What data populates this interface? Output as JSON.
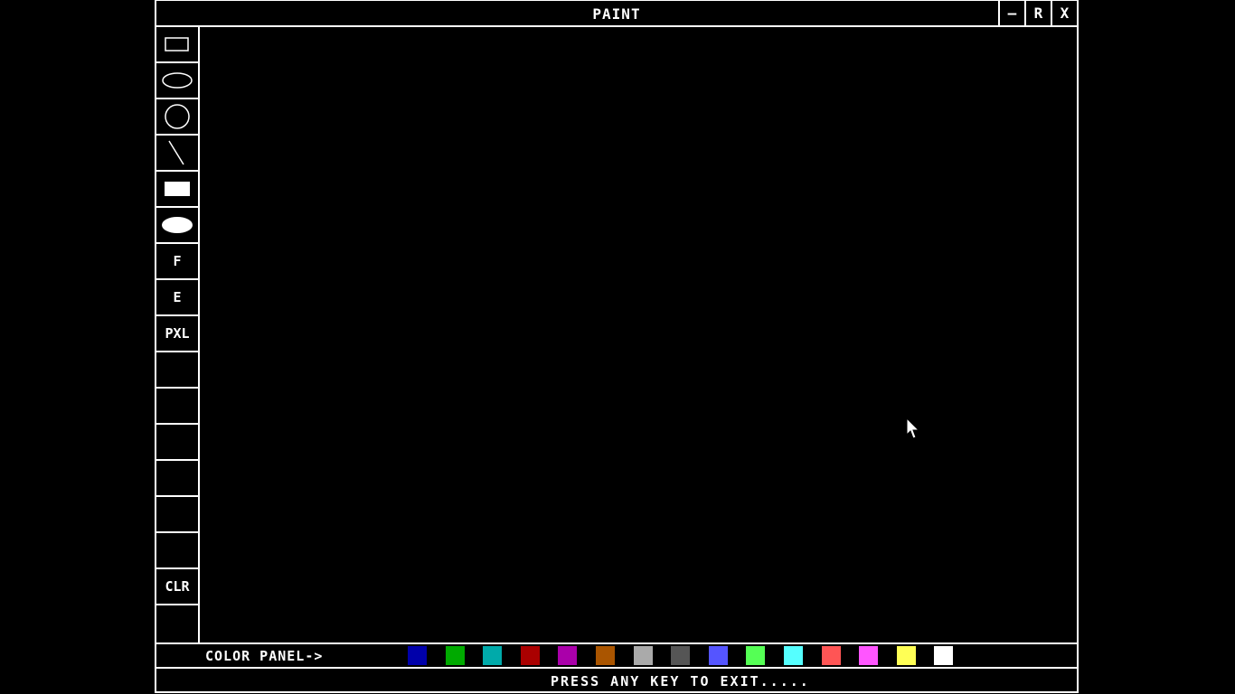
{
  "window": {
    "title": "PAINT",
    "controls": {
      "minimize": "–",
      "restore": "R",
      "close": "X"
    }
  },
  "toolbar": {
    "tools": [
      {
        "name": "rectangle-outline",
        "label": ""
      },
      {
        "name": "ellipse-outline",
        "label": ""
      },
      {
        "name": "circle-outline",
        "label": ""
      },
      {
        "name": "line",
        "label": ""
      },
      {
        "name": "rectangle-filled",
        "label": ""
      },
      {
        "name": "ellipse-filled",
        "label": ""
      },
      {
        "name": "fill",
        "label": "F"
      },
      {
        "name": "eraser",
        "label": "E"
      },
      {
        "name": "pixel",
        "label": "PXL"
      },
      {
        "name": "empty-1",
        "label": ""
      },
      {
        "name": "empty-2",
        "label": ""
      },
      {
        "name": "empty-3",
        "label": ""
      },
      {
        "name": "empty-4",
        "label": ""
      },
      {
        "name": "empty-5",
        "label": ""
      },
      {
        "name": "empty-6",
        "label": ""
      },
      {
        "name": "clear",
        "label": "CLR"
      }
    ]
  },
  "color_panel": {
    "label": "COLOR PANEL->",
    "colors": [
      "#0000aa",
      "#00aa00",
      "#00aaaa",
      "#aa0000",
      "#aa00aa",
      "#aa5500",
      "#aaaaaa",
      "#555555",
      "#5555ff",
      "#55ff55",
      "#55ffff",
      "#ff5555",
      "#ff55ff",
      "#ffff55",
      "#ffffff"
    ]
  },
  "status": {
    "text": "PRESS ANY KEY TO EXIT....."
  }
}
